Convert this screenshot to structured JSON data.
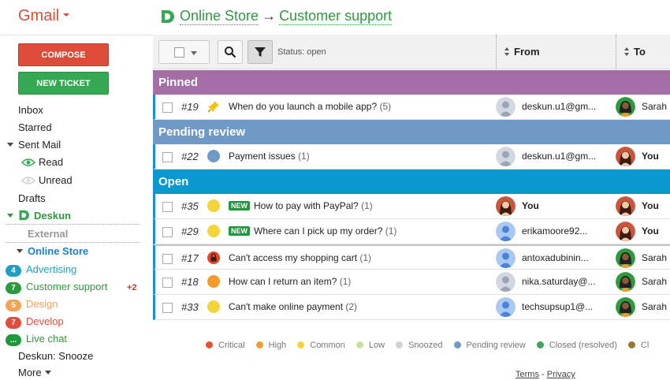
{
  "header": {
    "gmail_label": "Gmail",
    "crumb1": "Online Store",
    "arrow": "→",
    "crumb2": "Customer support"
  },
  "sidebar": {
    "compose": "COMPOSE",
    "new_ticket": "NEW TICKET",
    "inbox": "Inbox",
    "starred": "Starred",
    "sent_mail": "Sent Mail",
    "read": "Read",
    "unread": "Unread",
    "drafts": "Drafts",
    "deskun": "Deskun",
    "external": "External",
    "online_store": "Online Store",
    "advertising": {
      "count": "4",
      "label": "Advertising",
      "color": "#1ea0c4"
    },
    "customer_support": {
      "count": "7",
      "label": "Customer support",
      "extra": "+2",
      "color": "#2e9a3e"
    },
    "design": {
      "count": "5",
      "label": "Design",
      "color": "#f6a254"
    },
    "develop": {
      "count": "7",
      "label": "Develop",
      "color": "#e34b3a"
    },
    "live_chat": {
      "count": "...",
      "label": "Live chat",
      "color": "#2e9a3e"
    },
    "snooze": "Deskun: Snooze",
    "more": "More"
  },
  "toolbar": {
    "status": "Status: open",
    "from_col": "From",
    "to_col": "To"
  },
  "sections": {
    "pinned": {
      "label": "Pinned",
      "color": "#a46fa7"
    },
    "pending": {
      "label": "Pending review",
      "color": "#6f9ac5"
    },
    "open": {
      "label": "Open",
      "color": "#0b97d0"
    }
  },
  "tickets": [
    {
      "num": "#19",
      "prio": "pin-icon",
      "new": "",
      "subject": "When do you launch a mobile app?",
      "count": "(5)",
      "from": "deskun.u1@gm...",
      "from_avatar": "gray",
      "to": "Sarah G",
      "to_avatar": "sarah"
    },
    {
      "num": "#22",
      "prio": "#6f9ac5",
      "new": "",
      "subject": "Payment issues",
      "count": "(1)",
      "from": "deskun.u1@gm...",
      "from_avatar": "gray",
      "to": "You",
      "to_avatar": "you"
    },
    {
      "num": "#35",
      "prio": "#f5d33b",
      "new": "NEW",
      "subject": "How to pay with PayPal?",
      "count": "(1)",
      "from": "You",
      "from_avatar": "you",
      "to": "You",
      "to_avatar": "you"
    },
    {
      "num": "#29",
      "prio": "#f5d33b",
      "new": "NEW",
      "subject": "Where can I pick up my order?",
      "count": "(1)",
      "from": "erikamoore92...",
      "from_avatar": "blue",
      "to": "You",
      "to_avatar": "you"
    },
    {
      "num": "#17",
      "prio": "lock-icon",
      "new": "",
      "subject": "Can't access my shopping cart",
      "count": "(1)",
      "from": "antoxadubinin...",
      "from_avatar": "blue",
      "to": "Sarah G",
      "to_avatar": "sarah"
    },
    {
      "num": "#18",
      "prio": "#f59a2b",
      "new": "",
      "subject": "How can I return an item?",
      "count": "(1)",
      "from": "nika.saturday@...",
      "from_avatar": "gray",
      "to": "Sarah G",
      "to_avatar": "sarah"
    },
    {
      "num": "#33",
      "prio": "#f5d33b",
      "new": "",
      "subject": "Can't make online payment",
      "count": "(2)",
      "from": "techsupsup1@...",
      "from_avatar": "blue",
      "to": "Sarah G",
      "to_avatar": "sarah"
    }
  ],
  "legend": [
    {
      "label": "Critical",
      "color": "#f0512d"
    },
    {
      "label": "High",
      "color": "#f59a2b"
    },
    {
      "label": "Common",
      "color": "#f5d33b"
    },
    {
      "label": "Low",
      "color": "#c6e0a0"
    },
    {
      "label": "Snoozed",
      "color": "#d2d2d2"
    },
    {
      "label": "Pending review",
      "color": "#6f9ac5"
    },
    {
      "label": "Closed (resolved)",
      "color": "#3aa65b"
    },
    {
      "label": "Cl",
      "color": "#9a7a2a"
    }
  ],
  "footer": {
    "terms": "Terms",
    "dash": " - ",
    "privacy": "Privacy"
  }
}
